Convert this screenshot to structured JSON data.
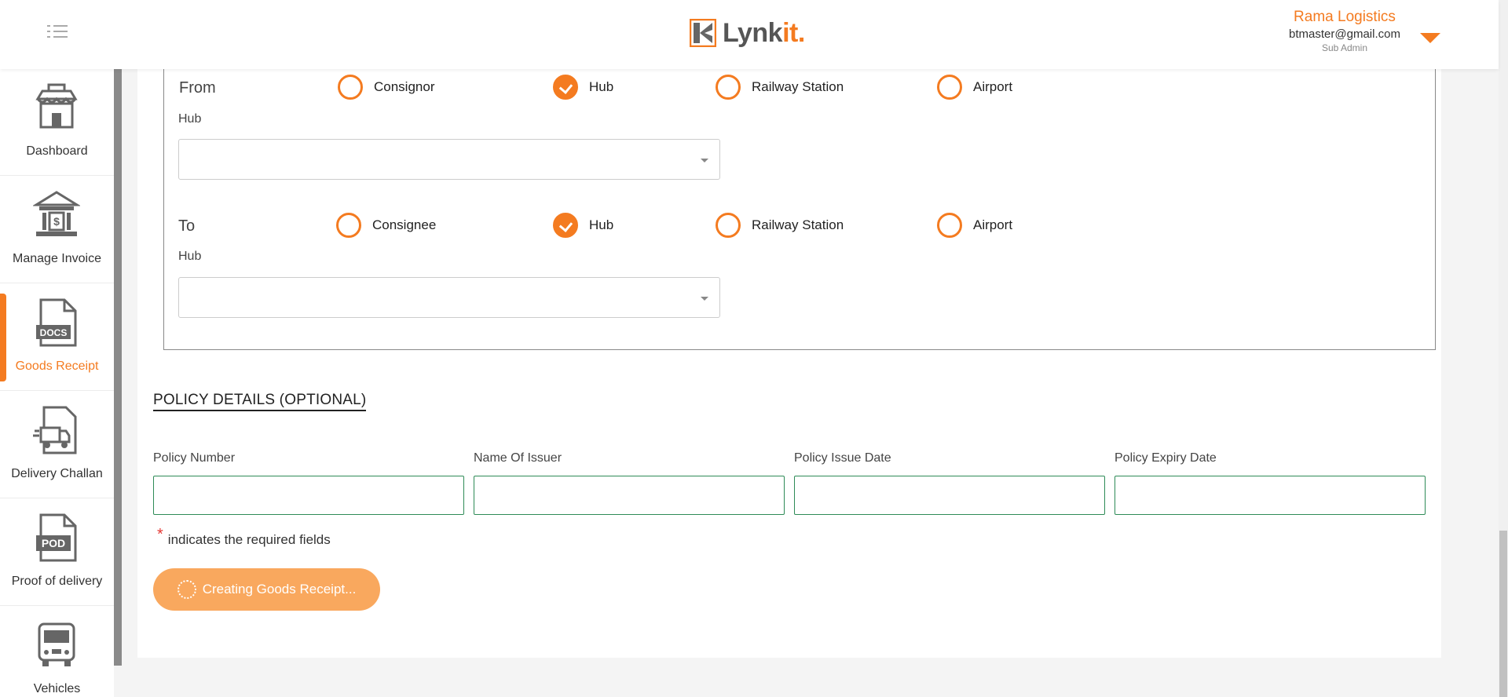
{
  "header": {
    "logo_text_main": "Lynk",
    "logo_text_accent": "it.",
    "user_company": "Rama Logistics",
    "user_email": "btmaster@gmail.com",
    "user_role": "Sub Admin"
  },
  "sidebar": {
    "items": [
      {
        "label": "Dashboard",
        "icon": "store-icon"
      },
      {
        "label": "Manage Invoice",
        "icon": "bank-icon"
      },
      {
        "label": "Goods Receipt",
        "icon": "docs-file-icon",
        "active": true
      },
      {
        "label": "Delivery Challan",
        "icon": "delivery-truck-doc-icon"
      },
      {
        "label": "Proof of delivery",
        "icon": "pod-file-icon"
      },
      {
        "label": "Vehicles",
        "icon": "bus-icon"
      }
    ]
  },
  "route": {
    "from": {
      "label": "From",
      "options": [
        "Consignor",
        "Hub",
        "Railway Station",
        "Airport"
      ],
      "selected": "Hub",
      "field_label": "Hub",
      "value": ""
    },
    "to": {
      "label": "To",
      "options": [
        "Consignee",
        "Hub",
        "Railway Station",
        "Airport"
      ],
      "selected": "Hub",
      "field_label": "Hub",
      "value": ""
    }
  },
  "policy": {
    "title": "POLICY DETAILS (OPTIONAL)",
    "fields": [
      {
        "label": "Policy Number",
        "value": ""
      },
      {
        "label": "Name Of Issuer",
        "value": ""
      },
      {
        "label": "Policy Issue Date",
        "value": ""
      },
      {
        "label": "Policy Expiry Date",
        "value": ""
      }
    ]
  },
  "form": {
    "required_star": "*",
    "required_note": "indicates the required fields",
    "submit_label": "Creating Goods Receipt..."
  },
  "colors": {
    "accent": "#f47b20",
    "input_border": "#2e8b57",
    "button_disabled": "#f9a85e"
  }
}
